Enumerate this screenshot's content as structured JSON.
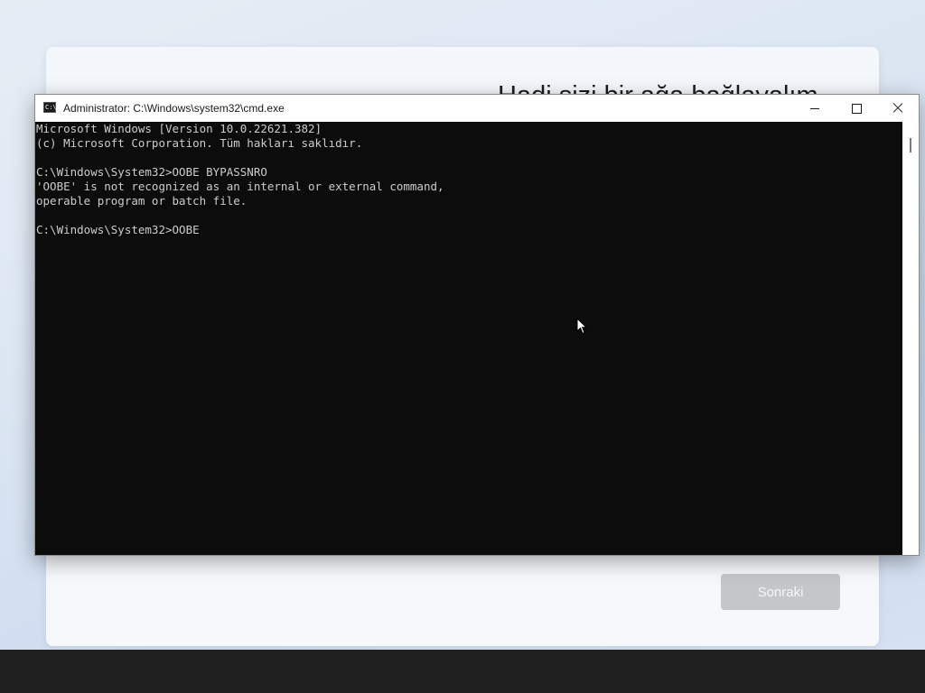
{
  "oobe": {
    "heading": "Hadi sizi bir ağa bağlayalım",
    "next_button": "Sonraki"
  },
  "cmd": {
    "title": "Administrator: C:\\Windows\\system32\\cmd.exe",
    "app_icon": "cmd-icon",
    "icon_text": "C:\\",
    "lines": [
      "Microsoft Windows [Version 10.0.22621.382]",
      "(c) Microsoft Corporation. Tüm hakları saklıdır.",
      "",
      "C:\\Windows\\System32>OOBE BYPASSNRO",
      "'OOBE' is not recognized as an internal or external command,",
      "operable program or batch file.",
      "",
      "C:\\Windows\\System32>OOBE"
    ]
  },
  "colors": {
    "console_bg": "#0c0c0c",
    "console_text": "#cccccc",
    "next_button_disabled": "#c4c6ca",
    "taskbar": "#202020"
  }
}
